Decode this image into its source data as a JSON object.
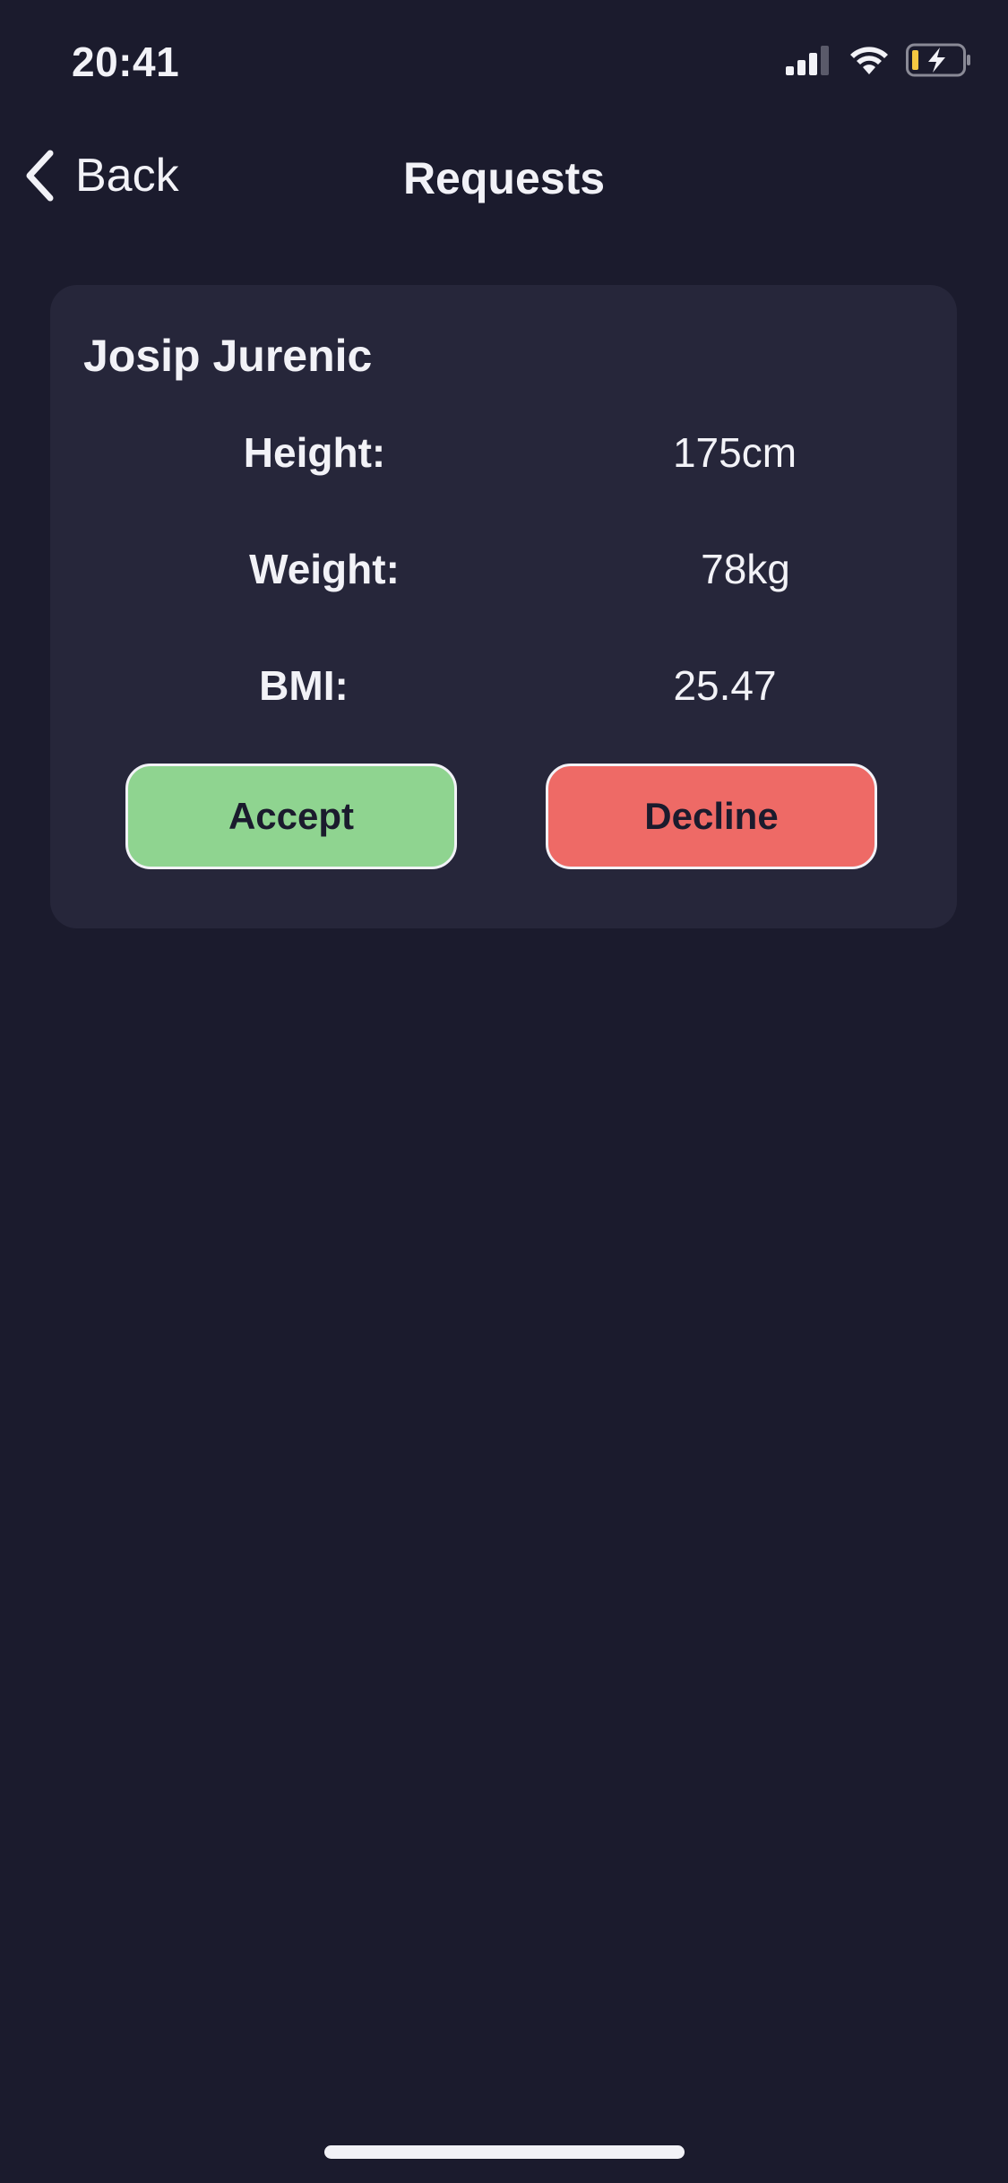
{
  "status_bar": {
    "time": "20:41"
  },
  "nav": {
    "back_label": "Back",
    "title": "Requests"
  },
  "request": {
    "name": "Josip Jurenic",
    "height_label": "Height:",
    "height_value": "175cm",
    "weight_label": "Weight:",
    "weight_value": "78kg",
    "bmi_label": "BMI:",
    "bmi_value": "25.47",
    "accept_label": "Accept",
    "decline_label": "Decline"
  },
  "colors": {
    "background": "#1b1b2d",
    "card": "#26263a",
    "accept": "#8fd490",
    "decline": "#ee6a66",
    "battery_accent": "#f5c842"
  }
}
